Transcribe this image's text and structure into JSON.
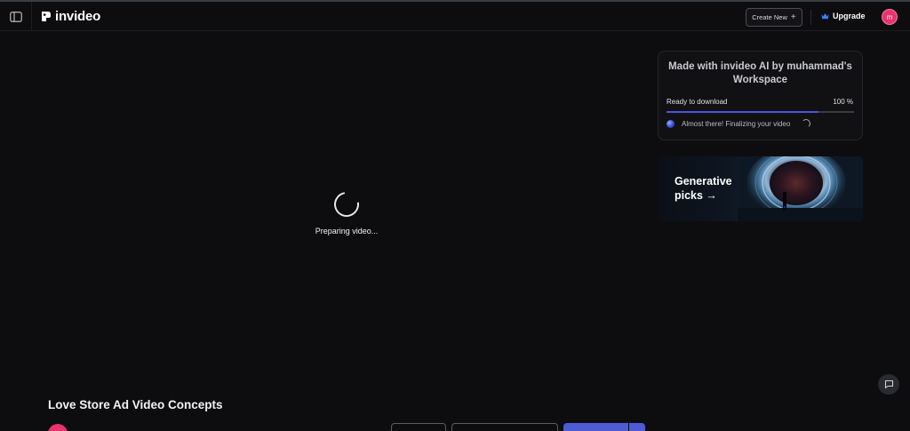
{
  "header": {
    "logo_text": "invideo",
    "create_new_label": "Create New",
    "create_new_icon": "plus-icon",
    "upgrade_label": "Upgrade",
    "upgrade_icon": "crown-icon",
    "avatar_initial": "m"
  },
  "player": {
    "status_text": "Preparing video..."
  },
  "export_card": {
    "title": "Made with invideo AI by muhammad's Workspace",
    "ready_label": "Ready to download",
    "percent_label": "100 %",
    "progress": 0.81,
    "finalizing_text": "Almost there! Finalizing your video"
  },
  "promo": {
    "label_line1": "Generative",
    "label_line2": "picks →"
  },
  "project": {
    "title": "Love Store Ad Video Concepts"
  },
  "colors": {
    "accent": "#4f5bd5",
    "avatar": "#e9336e",
    "background": "#0d0d0f"
  }
}
